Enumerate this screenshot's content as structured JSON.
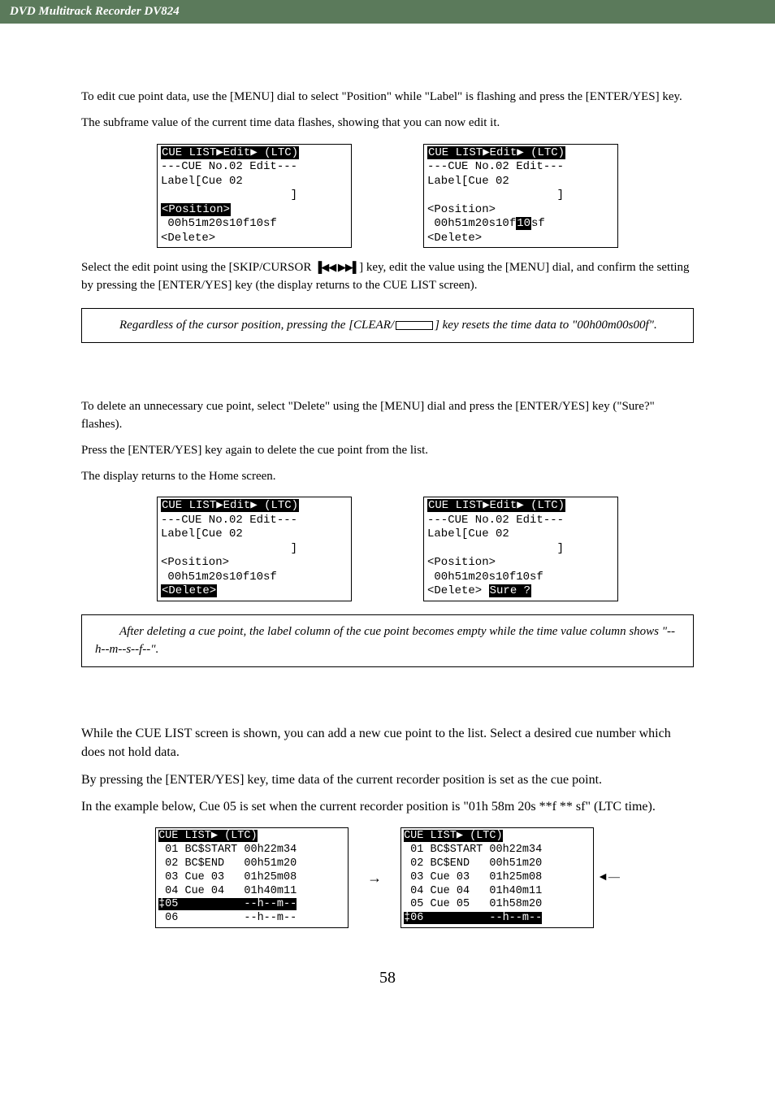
{
  "header": "DVD Multitrack Recorder DV824",
  "para1_a": "To edit cue point data, use the [MENU] dial to select \"Position\" while \"Label\" is flashing and press the [ENTER/YES] key.",
  "para1_b": "The subframe value of the current time data flashes, showing that you can now edit it.",
  "lcd1": {
    "title": "CUE LIST▶Edit▶ (LTC)",
    "l1": "---CUE No.02 Edit---",
    "l2": "Label[Cue 02",
    "l3": "                   ]",
    "pos_hl": "<Position>",
    "time": " 00h51m20s10f10sf",
    "del": "<Delete>"
  },
  "lcd2": {
    "title": "CUE LIST▶Edit▶ (LTC)",
    "l1": "---CUE No.02 Edit---",
    "l2": "Label[Cue 02",
    "l3": "                   ]",
    "pos": "<Position>",
    "time_a": " 00h51m20s10f",
    "time_hl": "10",
    "time_b": "sf",
    "del": "<Delete>"
  },
  "para2": "Select the edit point using the [SKIP/CURSOR ",
  "skip_icons": "▐◀◀ ▶▶▌",
  "para2_b": "] key, edit the value using the [MENU] dial, and confirm the setting by pressing the [ENTER/YES] key (the display returns to the CUE LIST screen).",
  "note1_a": "Regardless of the cursor position, pressing the [CLEAR/",
  "note1_b": "] key resets the time data to \"00h00m00s00f\".",
  "para3_a": "To delete an unnecessary cue point, select \"Delete\" using the [MENU] dial and press the [ENTER/YES] key (\"Sure?\" flashes).",
  "para3_b": "Press the [ENTER/YES] key again to delete the cue point from the list.",
  "para3_c": "The display returns to the Home screen.",
  "lcd3": {
    "title": "CUE LIST▶Edit▶ (LTC)",
    "l1": "---CUE No.02 Edit---",
    "l2": "Label[Cue 02",
    "l3": "                   ]",
    "pos": "<Position>",
    "time": " 00h51m20s10f10sf",
    "del_hl": "<Delete>"
  },
  "lcd4": {
    "title": "CUE LIST▶Edit▶ (LTC)",
    "l1": "---CUE No.02 Edit---",
    "l2": "Label[Cue 02",
    "l3": "                   ]",
    "pos": "<Position>",
    "time": " 00h51m20s10f10sf",
    "del": "<Delete> ",
    "sure_hl": "Sure ?"
  },
  "note2": "After deleting a cue point, the label column of the cue point becomes empty while the time value column shows \"--h--m--s--f--\".",
  "para4_a": "While the CUE LIST screen is shown, you can add a new cue point to the list. Select a desired cue number which does not hold data.",
  "para4_b": "By pressing the [ENTER/YES] key, time data of the current recorder position is set as the cue point.",
  "para4_c": "In the example below, Cue 05 is set when the current recorder position is \"01h 58m 20s **f ** sf\" (LTC time).",
  "list_left": {
    "title": "CUE LIST▶ (LTC)",
    "r1": " 01 BC$START 00h22m34",
    "r2": " 02 BC$END   00h51m20",
    "r3": " 03 Cue 03   01h25m08",
    "r4": " 04 Cue 04   01h40m11",
    "r5_hl": "‡05          --h--m--",
    "r6": " 06          --h--m--"
  },
  "list_right": {
    "title": "CUE LIST▶ (LTC)",
    "r1": " 01 BC$START 00h22m34",
    "r2": " 02 BC$END   00h51m20",
    "r3": " 03 Cue 03   01h25m08",
    "r4": " 04 Cue 04   01h40m11",
    "r5": " 05 Cue 05   01h58m20",
    "r6_hl": "‡06          --h--m--"
  },
  "page_number": "58",
  "arrow_right": "→",
  "arrow_left": "◄—"
}
